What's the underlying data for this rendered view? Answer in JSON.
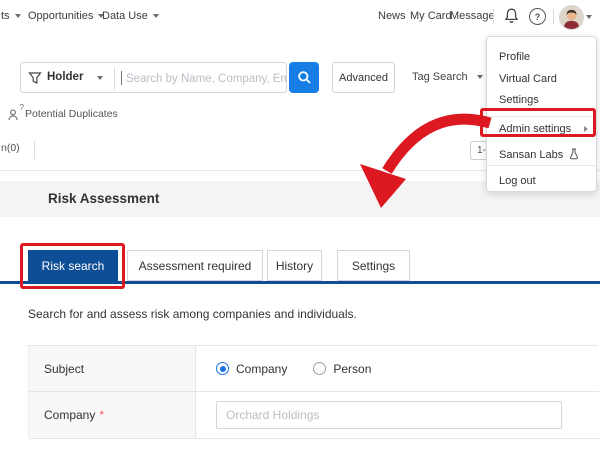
{
  "nav": {
    "items_left": [
      {
        "label": "ts"
      },
      {
        "label": "Opportunities"
      },
      {
        "label": "Data Use"
      }
    ],
    "items_right": [
      {
        "label": "News"
      },
      {
        "label": "My Card"
      },
      {
        "label": "Message"
      }
    ]
  },
  "icons": {
    "help_glyph": "?",
    "dup_question": "?"
  },
  "user_menu": {
    "profile": "Profile",
    "virtual_card": "Virtual Card",
    "settings": "Settings",
    "admin_settings": "Admin settings",
    "sansan_labs": "Sansan Labs",
    "log_out": "Log out"
  },
  "search_bar": {
    "filter_label": "Holder",
    "placeholder": "Search by Name, Company, Email or Phone",
    "advanced": "Advanced",
    "tag_search": "Tag Search"
  },
  "sub_toolbar": {
    "potential_duplicates": "Potential Duplicates",
    "left_edge_text": "n(0)",
    "pagination": "1-"
  },
  "risk_page": {
    "title": "Risk Assessment",
    "tabs": [
      {
        "label": "Risk search",
        "active": true
      },
      {
        "label": "Assessment required",
        "active": false
      },
      {
        "label": "History",
        "active": false
      },
      {
        "label": "Settings",
        "active": false
      }
    ],
    "description": "Search for and assess risk among companies and individuals.",
    "form": {
      "subject_label": "Subject",
      "subject_options": [
        {
          "label": "Company",
          "selected": true
        },
        {
          "label": "Person",
          "selected": false
        }
      ],
      "company_label": "Company",
      "required_mark": "*",
      "company_placeholder": "Orchard Holdings"
    }
  },
  "colors": {
    "primary_navy": "#0e4e96",
    "action_blue": "#177ee6",
    "radio_blue": "#1a73e8",
    "annotation_red": "#dc1820"
  }
}
